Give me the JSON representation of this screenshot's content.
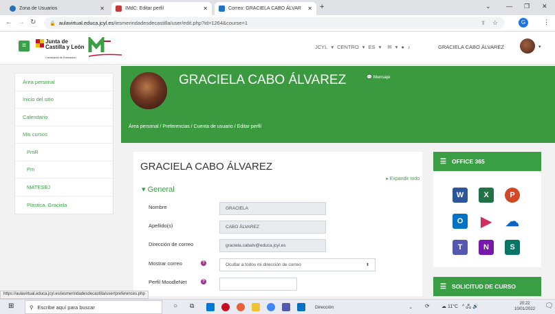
{
  "browser": {
    "tabs": [
      {
        "label": "Zona de Usuarios",
        "color": "#2b6fb6"
      },
      {
        "label": "IMdC: Editar perfil",
        "color": "#c23b3b"
      },
      {
        "label": "Correo: GRACIELA CABO ÁLVAR",
        "color": "#1f73c9"
      }
    ],
    "new_tab": "+",
    "url_domain": "aulavirtual.educa.jcyl.es",
    "url_path": "/iesmerindadesdecastilla/user/edit.php?id=1264&course=1",
    "profile_initial": "G"
  },
  "header": {
    "jcyl_line1": "Junta de",
    "jcyl_line2": "Castilla y León",
    "jcyl_sub": "Consejería de Educación",
    "menu": [
      "JCYL",
      "CENTRO",
      "ES"
    ],
    "user_name": "GRACIELA CABO ÁLVAREZ"
  },
  "sidebar": {
    "items": [
      {
        "label": "Área personal"
      },
      {
        "label": "Inicio del sitio"
      },
      {
        "label": "Calendario"
      },
      {
        "label": "Mis cursos"
      },
      {
        "label": "PmR"
      },
      {
        "label": "Pm"
      },
      {
        "label": "MATESBJ"
      },
      {
        "label": "Plástica. Graciela"
      }
    ]
  },
  "banner": {
    "name": "GRACIELA CABO ÁLVAREZ",
    "message": "Mensaje",
    "breadcrumb": "Área personal  /  Preferencias  /  Cuenta de usuario  /  Editar perfil"
  },
  "form": {
    "title": "GRACIELA CABO ÁLVAREZ",
    "expand_all": "Expandir todo",
    "section": "General",
    "fields": [
      {
        "label": "Nombre",
        "value": "GRACIELA"
      },
      {
        "label": "Apellido(s)",
        "value": "CABO ÁLVAREZ"
      },
      {
        "label": "Dirección de correo",
        "value": "graciela.cabalv@educa.jcyl.es"
      },
      {
        "label": "Mostrar correo",
        "value": "Ocultar a todos mi dirección de correo"
      },
      {
        "label": "Perfil MoodleNet",
        "value": ""
      }
    ]
  },
  "blocks": {
    "office": "OFFICE 365",
    "solicitud": "SOLICITUD DE CURSO"
  },
  "status_url": "https://aulavirtual.educa.jcyl.es/iesmerindadesdecastilla/user/preferences.php",
  "taskbar": {
    "search_placeholder": "Escribe aquí para buscar",
    "direccion": "Dirección",
    "weather": "11°C",
    "time": "20:22",
    "date": "10/01/2022"
  }
}
